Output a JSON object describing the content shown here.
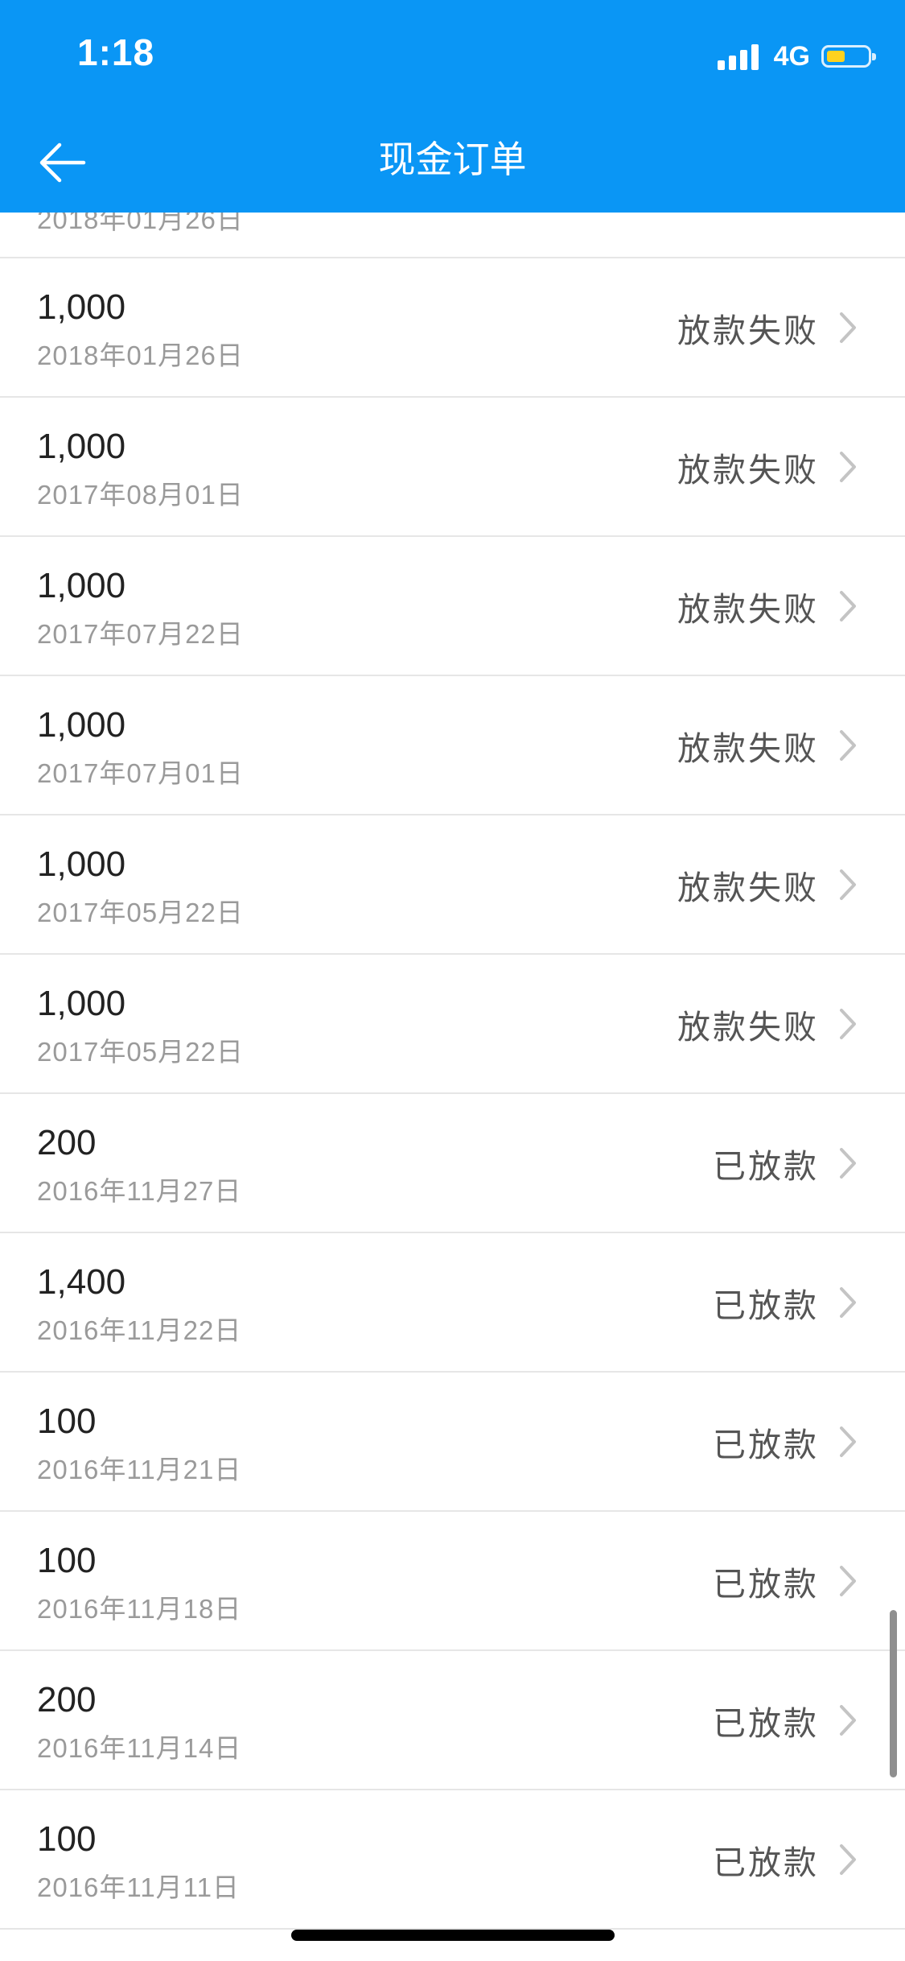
{
  "status_bar": {
    "time": "1:18",
    "network": "4G"
  },
  "header": {
    "title": "现金订单"
  },
  "partial_item": {
    "date": "2018年01月26日"
  },
  "orders": [
    {
      "amount": "1,000",
      "date": "2018年01月26日",
      "status": "放款失败"
    },
    {
      "amount": "1,000",
      "date": "2017年08月01日",
      "status": "放款失败"
    },
    {
      "amount": "1,000",
      "date": "2017年07月22日",
      "status": "放款失败"
    },
    {
      "amount": "1,000",
      "date": "2017年07月01日",
      "status": "放款失败"
    },
    {
      "amount": "1,000",
      "date": "2017年05月22日",
      "status": "放款失败"
    },
    {
      "amount": "1,000",
      "date": "2017年05月22日",
      "status": "放款失败"
    },
    {
      "amount": "200",
      "date": "2016年11月27日",
      "status": "已放款"
    },
    {
      "amount": "1,400",
      "date": "2016年11月22日",
      "status": "已放款"
    },
    {
      "amount": "100",
      "date": "2016年11月21日",
      "status": "已放款"
    },
    {
      "amount": "100",
      "date": "2016年11月18日",
      "status": "已放款"
    },
    {
      "amount": "200",
      "date": "2016年11月14日",
      "status": "已放款"
    },
    {
      "amount": "100",
      "date": "2016年11月11日",
      "status": "已放款"
    }
  ],
  "icons": {
    "back": "arrow-left-icon",
    "chevron": "chevron-right-icon",
    "signal": "signal-icon",
    "battery": "battery-icon"
  },
  "colors": {
    "header_bg": "#0a96f5",
    "battery_level": "#ffd21f"
  }
}
